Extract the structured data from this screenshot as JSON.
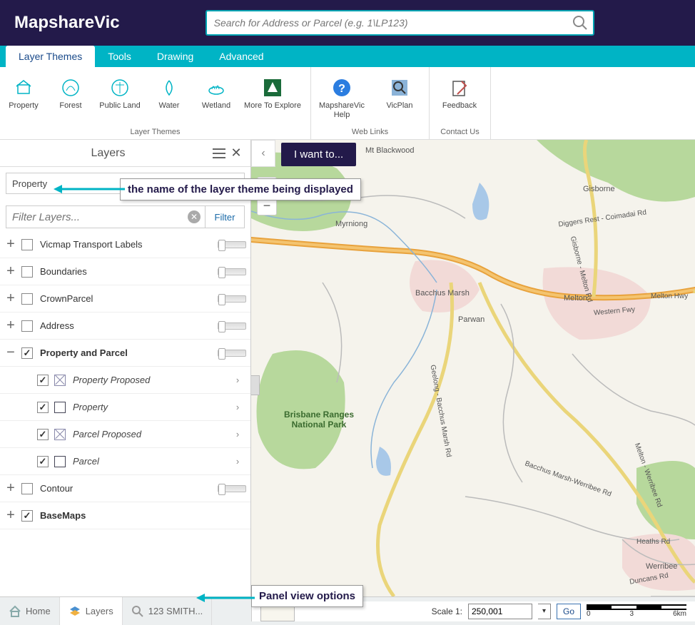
{
  "header": {
    "logo": "MapshareVic",
    "search_placeholder": "Search for Address or Parcel (e.g. 1\\LP123)"
  },
  "tabs": [
    "Layer Themes",
    "Tools",
    "Drawing",
    "Advanced"
  ],
  "ribbon": {
    "groups": [
      {
        "label": "Layer Themes",
        "items": [
          {
            "label": "Property",
            "icon": "property"
          },
          {
            "label": "Forest",
            "icon": "forest"
          },
          {
            "label": "Public Land",
            "icon": "publicland"
          },
          {
            "label": "Water",
            "icon": "water"
          },
          {
            "label": "Wetland",
            "icon": "wetland"
          },
          {
            "label": "More To Explore",
            "icon": "more"
          }
        ]
      },
      {
        "label": "Web Links",
        "items": [
          {
            "label": "MapshareVic Help",
            "icon": "help"
          },
          {
            "label": "VicPlan",
            "icon": "vicplan"
          }
        ]
      },
      {
        "label": "Contact Us",
        "items": [
          {
            "label": "Feedback",
            "icon": "feedback"
          }
        ]
      }
    ]
  },
  "panel": {
    "title": "Layers",
    "theme_selected": "Property",
    "filter_placeholder": "Filter Layers...",
    "filter_button": "Filter",
    "layers": [
      {
        "name": "Vicmap Transport Labels",
        "checked": false,
        "expanded": false,
        "slider": true
      },
      {
        "name": "Boundaries",
        "checked": false,
        "expanded": false,
        "slider": true
      },
      {
        "name": "CrownParcel",
        "checked": false,
        "expanded": false,
        "slider": true
      },
      {
        "name": "Address",
        "checked": false,
        "expanded": false,
        "slider": true
      },
      {
        "name": "Property and Parcel",
        "checked": true,
        "expanded": true,
        "slider": true,
        "sublayers": [
          {
            "name": "Property Proposed",
            "checked": true,
            "swatch": "x"
          },
          {
            "name": "Property",
            "checked": true,
            "swatch": "open"
          },
          {
            "name": "Parcel Proposed",
            "checked": true,
            "swatch": "x"
          },
          {
            "name": "Parcel",
            "checked": true,
            "swatch": "open"
          }
        ]
      },
      {
        "name": "Contour",
        "checked": false,
        "expanded": false,
        "slider": true
      },
      {
        "name": "BaseMaps",
        "checked": true,
        "expanded": false,
        "slider": false
      }
    ]
  },
  "map": {
    "i_want_to": "I want to...",
    "places": {
      "myrniong": "Myrniong",
      "mt_blackwood": "Mt Blackwood",
      "bacchus_marsh": "Bacchus Marsh",
      "parwan": "Parwan",
      "melton": "Melton",
      "werribee": "Werribee",
      "gisborne": "Gisborne",
      "park": "Brisbane Ranges National Park"
    },
    "roads": {
      "diggers": "Diggers Rest - Coimadai Rd",
      "western": "Western Fwy",
      "melton_hwy": "Melton Hwy",
      "geelong": "Geelong - Bacchus Marsh Rd",
      "werribee_rd1": "Melton - Werribee Rd",
      "bacchus_werribee": "Bacchus Marsh-Werribee Rd",
      "heaths": "Heaths Rd",
      "duncans": "Duncans Rd",
      "gisborne_melton": "Gisborne - Melton Rd"
    }
  },
  "status": {
    "home": "Home",
    "layers": "Layers",
    "search_crumb": "123 SMITH...",
    "scale_label": "Scale 1:",
    "scale_value": "250,001",
    "go": "Go",
    "scalebar": {
      "t0": "0",
      "t1": "3",
      "t2": "6km"
    }
  },
  "annotations": {
    "theme_callout": "the name of the layer theme being displayed",
    "panel_callout": "Panel view options"
  }
}
